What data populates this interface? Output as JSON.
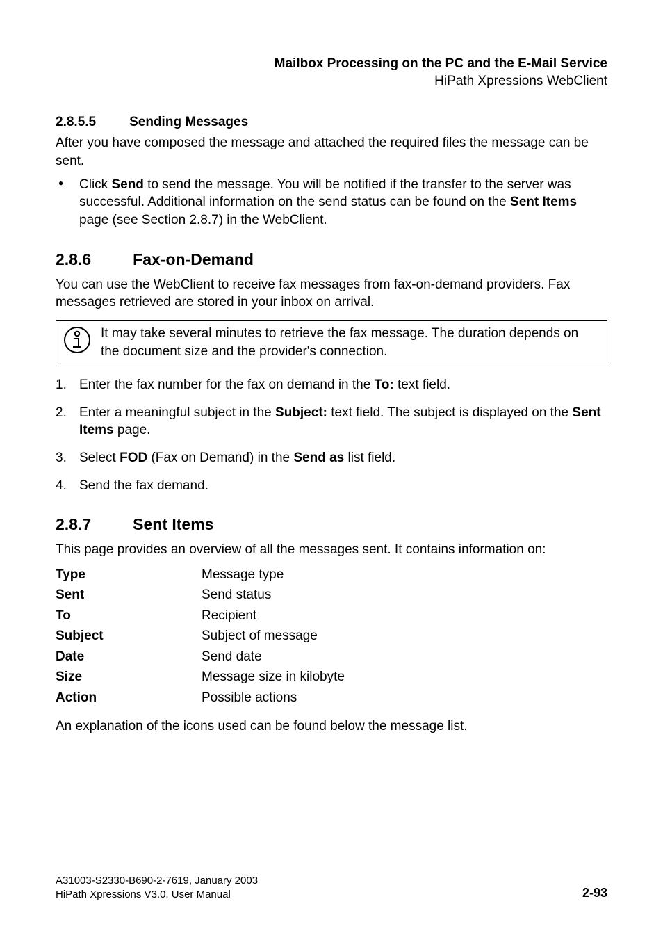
{
  "header": {
    "title": "Mailbox Processing on the PC and the E-Mail Service",
    "subtitle": "HiPath Xpressions WebClient"
  },
  "s2855": {
    "num": "2.8.5.5",
    "title": "Sending Messages",
    "intro": "After you have composed the message and attached the required files the message can be sent.",
    "bullet_pre": "Click ",
    "bullet_b1": "Send",
    "bullet_mid1": " to send the message. You will be notified if the transfer to the server was successful. Additional information on the send status can be found on the ",
    "bullet_b2": "Sent Items",
    "bullet_post": " page (see Section 2.8.7) in the WebClient."
  },
  "s286": {
    "num": "2.8.6",
    "title": "Fax-on-Demand",
    "intro": "You can use the WebClient to receive fax messages from fax-on-demand providers. Fax messages retrieved are stored in your inbox on arrival.",
    "note": "It may take several minutes to retrieve the fax message. The duration depends on the document size and the provider's connection.",
    "steps": [
      {
        "num": "1.",
        "pre": "Enter the fax number for the fax on demand in the ",
        "b1": "To:",
        "post": " text field."
      },
      {
        "num": "2.",
        "pre": "Enter a meaningful subject in the ",
        "b1": "Subject:",
        "mid": " text field. The subject is displayed on the ",
        "b2": "Sent Items",
        "post": " page."
      },
      {
        "num": "3.",
        "pre": "Select ",
        "b1": "FOD",
        "mid": " (Fax on Demand) in the ",
        "b2": "Send as",
        "post": " list field."
      },
      {
        "num": "4.",
        "pre": "Send the fax demand.",
        "b1": "",
        "post": ""
      }
    ]
  },
  "s287": {
    "num": "2.8.7",
    "title": "Sent Items",
    "intro": "This page provides an overview of all the messages sent. It contains information on:",
    "defs": [
      {
        "term": "Type",
        "desc": "Message type"
      },
      {
        "term": "Sent",
        "desc": "Send status"
      },
      {
        "term": "To",
        "desc": "Recipient"
      },
      {
        "term": "Subject",
        "desc": "Subject of message"
      },
      {
        "term": "Date",
        "desc": "Send date"
      },
      {
        "term": "Size",
        "desc": "Message size in kilobyte"
      },
      {
        "term": "Action",
        "desc": "Possible actions"
      }
    ],
    "outro": "An explanation of the icons used can be found below the message list."
  },
  "footer": {
    "line1": "A31003-S2330-B690-2-7619, January 2003",
    "line2": "HiPath Xpressions V3.0, User Manual",
    "pagenum": "2-93"
  }
}
